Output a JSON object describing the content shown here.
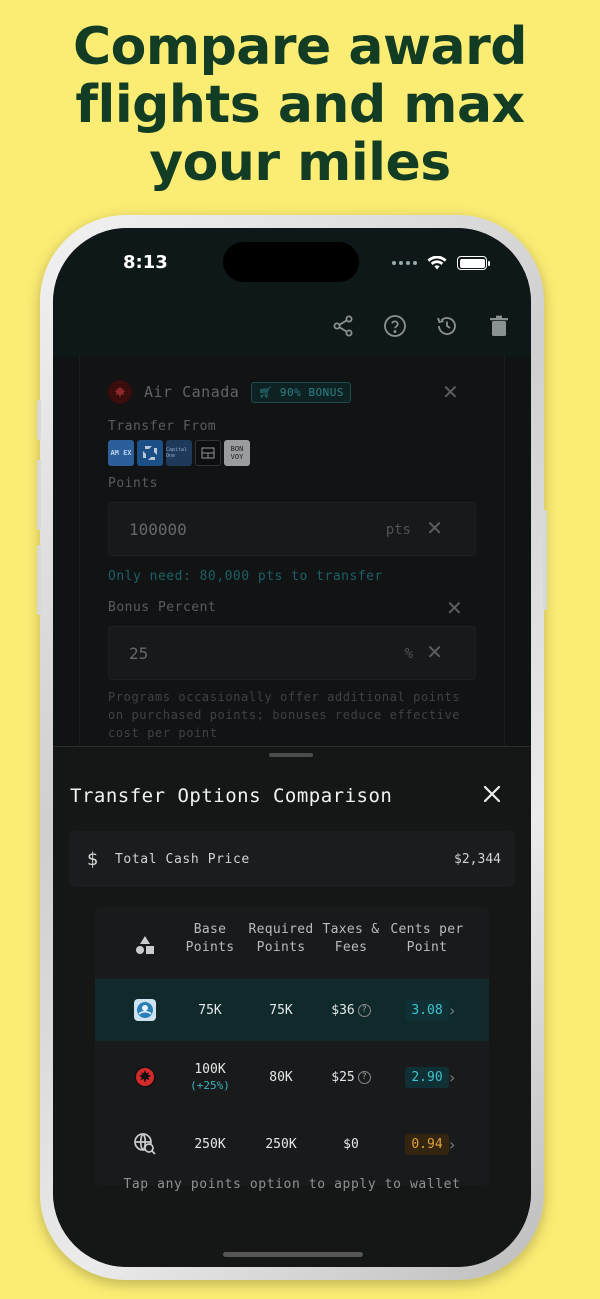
{
  "headline": [
    "Compare award",
    "flights and max",
    "your miles"
  ],
  "status_bar": {
    "time": "8:13"
  },
  "topbar": {
    "icons": [
      "share-icon",
      "help-icon",
      "history-icon",
      "trash-icon"
    ]
  },
  "form": {
    "airline_name": "Air Canada",
    "bonus_badge": "90% BONUS",
    "transfer_from_label": "Transfer From",
    "cards": [
      "AM EX",
      "Chase",
      "Capital One",
      "Citi",
      "BON VOY"
    ],
    "points_label": "Points",
    "points_value": "100000",
    "points_unit": "pts",
    "only_need": "Only need: 80,000 pts to transfer",
    "bonus_percent_label": "Bonus Percent",
    "bonus_value": "25",
    "bonus_unit": "%",
    "help_text": "Programs occasionally offer additional points on purchased points; bonuses reduce effective cost per point"
  },
  "sheet": {
    "title": "Transfer Options Comparison",
    "cash_label": "Total Cash Price",
    "cash_value": "$2,344",
    "headers": {
      "base": "Base\nPoints",
      "required": "Required\nPoints",
      "taxes": "Taxes &\nFees",
      "cpp": "Cents per\nPoint"
    },
    "rows": [
      {
        "icon": "aeroplan-icon",
        "base": "75K",
        "base_sub": "",
        "required": "75K",
        "taxes": "$36",
        "tax_info": true,
        "cpp": "3.08",
        "selected": true
      },
      {
        "icon": "air-canada-icon",
        "base": "100K",
        "base_sub": "(+25%)",
        "required": "80K",
        "taxes": "$25",
        "tax_info": true,
        "cpp": "2.90",
        "selected": false
      },
      {
        "icon": "search-globe-icon",
        "base": "250K",
        "base_sub": "",
        "required": "250K",
        "taxes": "$0",
        "tax_info": false,
        "cpp": "0.94",
        "selected": false
      }
    ],
    "footer": "Tap any points option to apply to wallet"
  },
  "colors": {
    "background": "#fbed73",
    "headline": "#123c23",
    "cpp_good": "#3fc3cf",
    "cpp_good_bg": "#0f3034",
    "cpp_low": "#e2a23b",
    "cpp_low_bg": "#332510"
  }
}
